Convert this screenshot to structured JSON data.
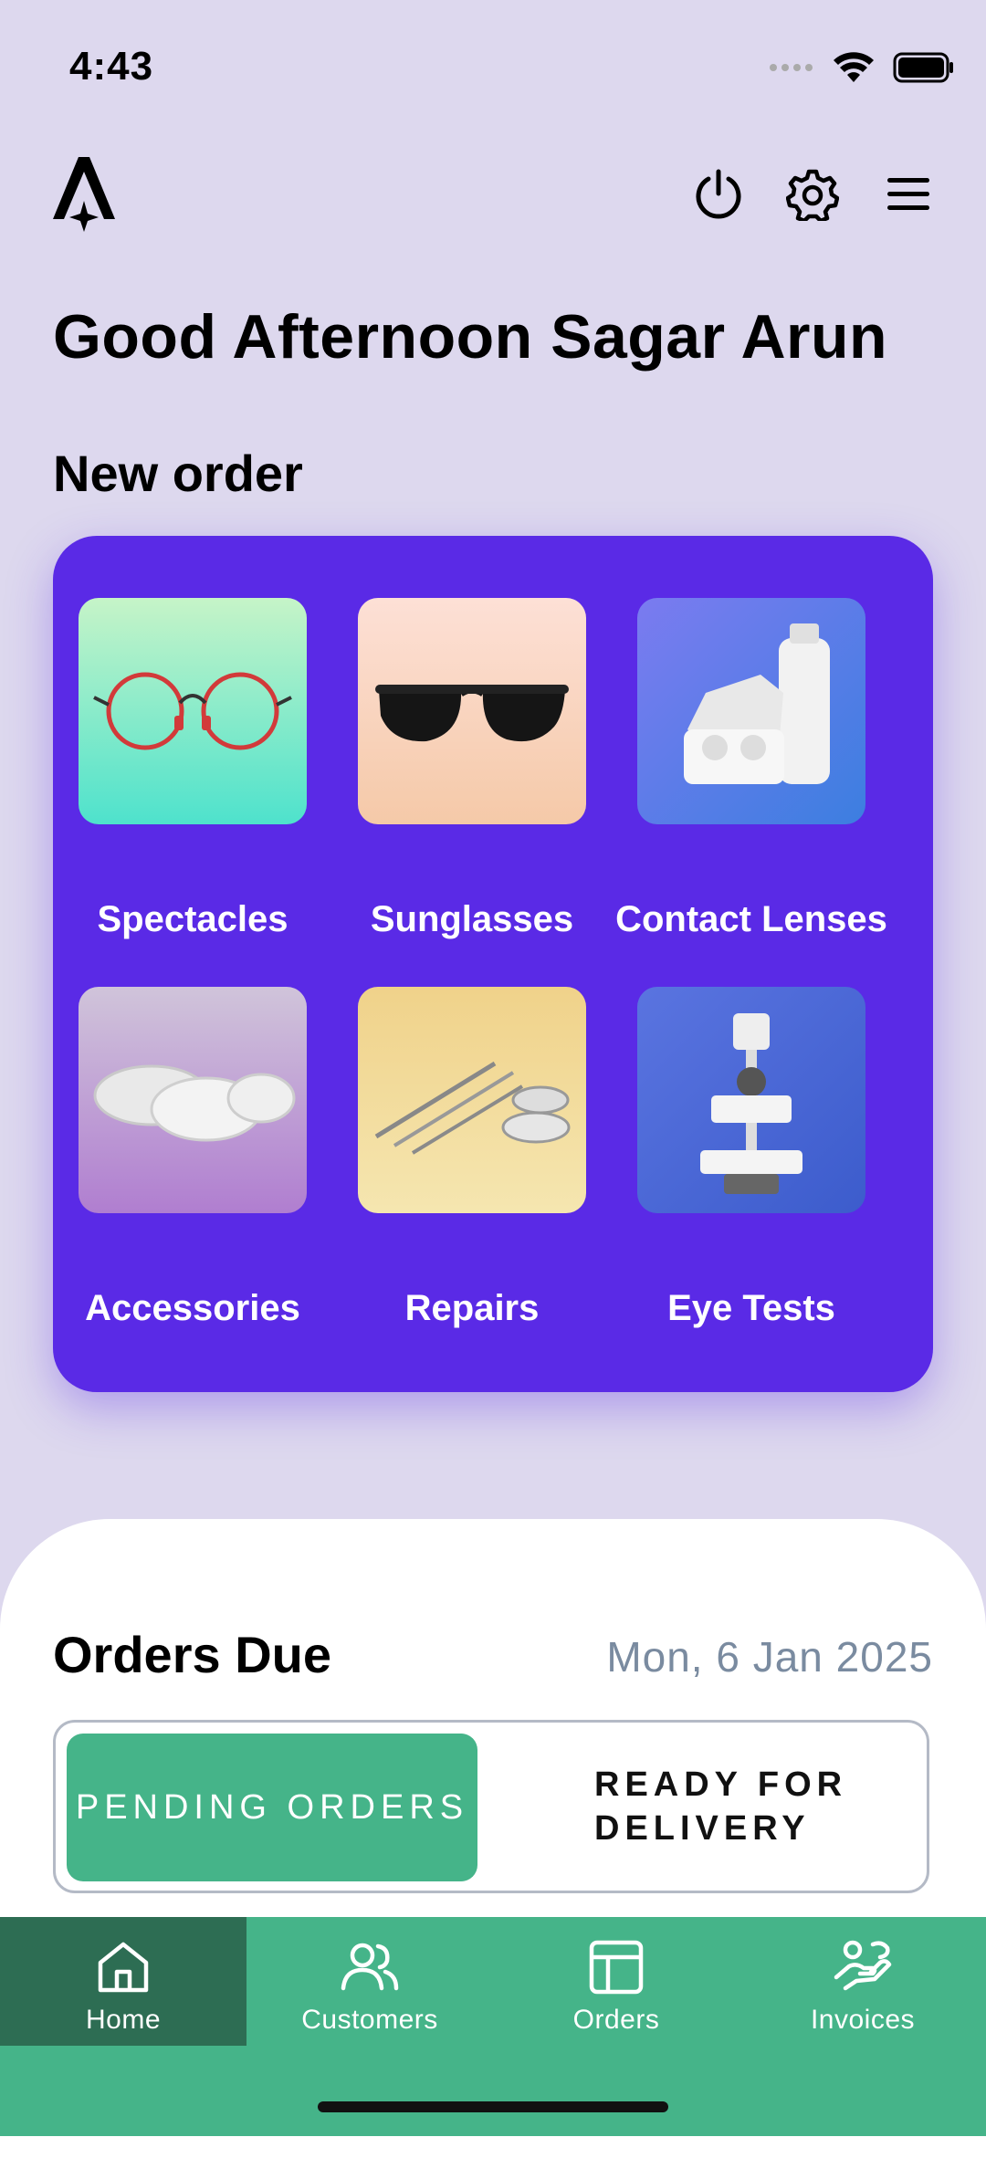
{
  "status": {
    "time": "4:43"
  },
  "header": {
    "greeting": "Good Afternoon Sagar Arun",
    "icons": [
      "power-icon",
      "gear-icon",
      "menu-icon"
    ]
  },
  "new_order": {
    "title": "New order",
    "categories": [
      {
        "label": "Spectacles"
      },
      {
        "label": "Sunglasses"
      },
      {
        "label": "Contact Lenses"
      },
      {
        "label": "Accessories"
      },
      {
        "label": "Repairs"
      },
      {
        "label": "Eye Tests"
      }
    ]
  },
  "orders_due": {
    "title": "Orders Due",
    "date": "Mon, 6 Jan 2025",
    "tabs": {
      "pending": "PENDING ORDERS",
      "ready": "READY FOR DELIVERY"
    }
  },
  "nav": {
    "items": [
      {
        "label": "Home",
        "icon": "home-icon",
        "active": true
      },
      {
        "label": "Customers",
        "icon": "users-icon",
        "active": false
      },
      {
        "label": "Orders",
        "icon": "table-icon",
        "active": false
      },
      {
        "label": "Invoices",
        "icon": "hand-money-icon",
        "active": false
      }
    ]
  },
  "colors": {
    "background": "#ddd8ee",
    "card": "#5a2ae6",
    "accent_green": "#45b489",
    "active_nav": "#2d6d53",
    "date_text": "#7a8ba0"
  }
}
